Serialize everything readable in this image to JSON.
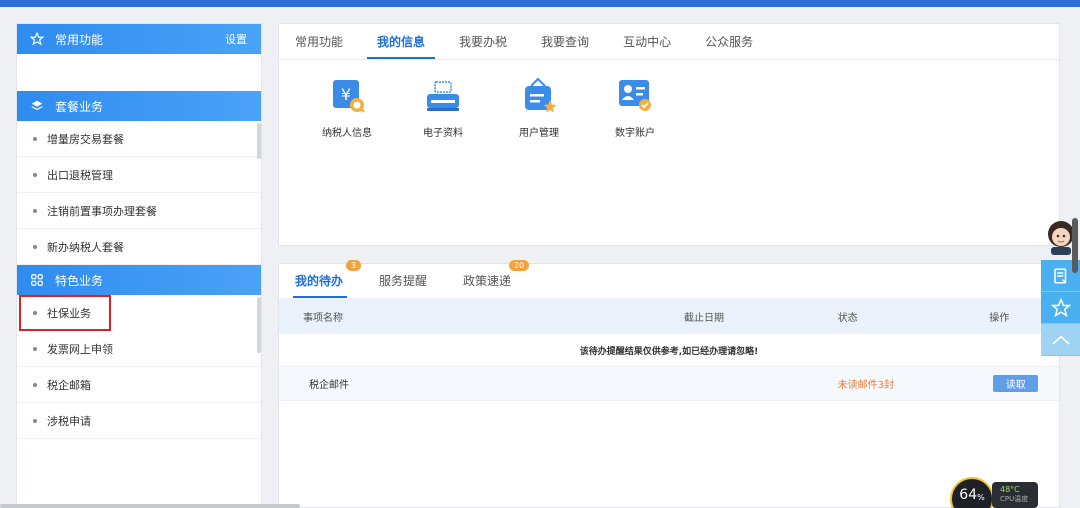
{
  "sidebar": {
    "common": {
      "title": "常用功能",
      "settings_label": "设置"
    },
    "package": {
      "title": "套餐业务",
      "items": [
        {
          "label": "增量房交易套餐"
        },
        {
          "label": "出口退税管理"
        },
        {
          "label": "注销前置事项办理套餐"
        },
        {
          "label": "新办纳税人套餐"
        }
      ]
    },
    "special": {
      "title": "特色业务",
      "items": [
        {
          "label": "社保业务"
        },
        {
          "label": "发票网上申领"
        },
        {
          "label": "税企邮箱"
        },
        {
          "label": "涉税申请"
        }
      ]
    }
  },
  "main_tabs": [
    "常用功能",
    "我的信息",
    "我要办税",
    "我要查询",
    "互动中心",
    "公众服务"
  ],
  "active_main_tab": "我的信息",
  "apps": [
    {
      "label": "纳税人信息",
      "icon": "taxpayer-info-icon"
    },
    {
      "label": "电子资料",
      "icon": "electronic-docs-icon"
    },
    {
      "label": "用户管理",
      "icon": "user-management-icon"
    },
    {
      "label": "数字账户",
      "icon": "digital-account-icon"
    }
  ],
  "todo": {
    "tabs": [
      {
        "label": "我的待办",
        "badge": "3"
      },
      {
        "label": "服务提醒",
        "badge": ""
      },
      {
        "label": "政策速递",
        "badge": "20"
      }
    ],
    "columns": [
      "事项名称",
      "截止日期",
      "状态",
      "操作"
    ],
    "notice": "该待办提醒结果仅供参考,如已经办理请忽略!",
    "rows": [
      {
        "name": "税企邮件",
        "deadline": "",
        "status": "未读邮件3封",
        "action": "读取"
      }
    ]
  },
  "cpu": {
    "percent": "64",
    "unit": "%",
    "temp": "48°C",
    "label": "CPU温度"
  },
  "colors": {
    "accent": "#1f6fd6",
    "header_blue": "#2f8bef",
    "status_orange": "#ef7b3a",
    "highlight_red": "#e02020"
  }
}
